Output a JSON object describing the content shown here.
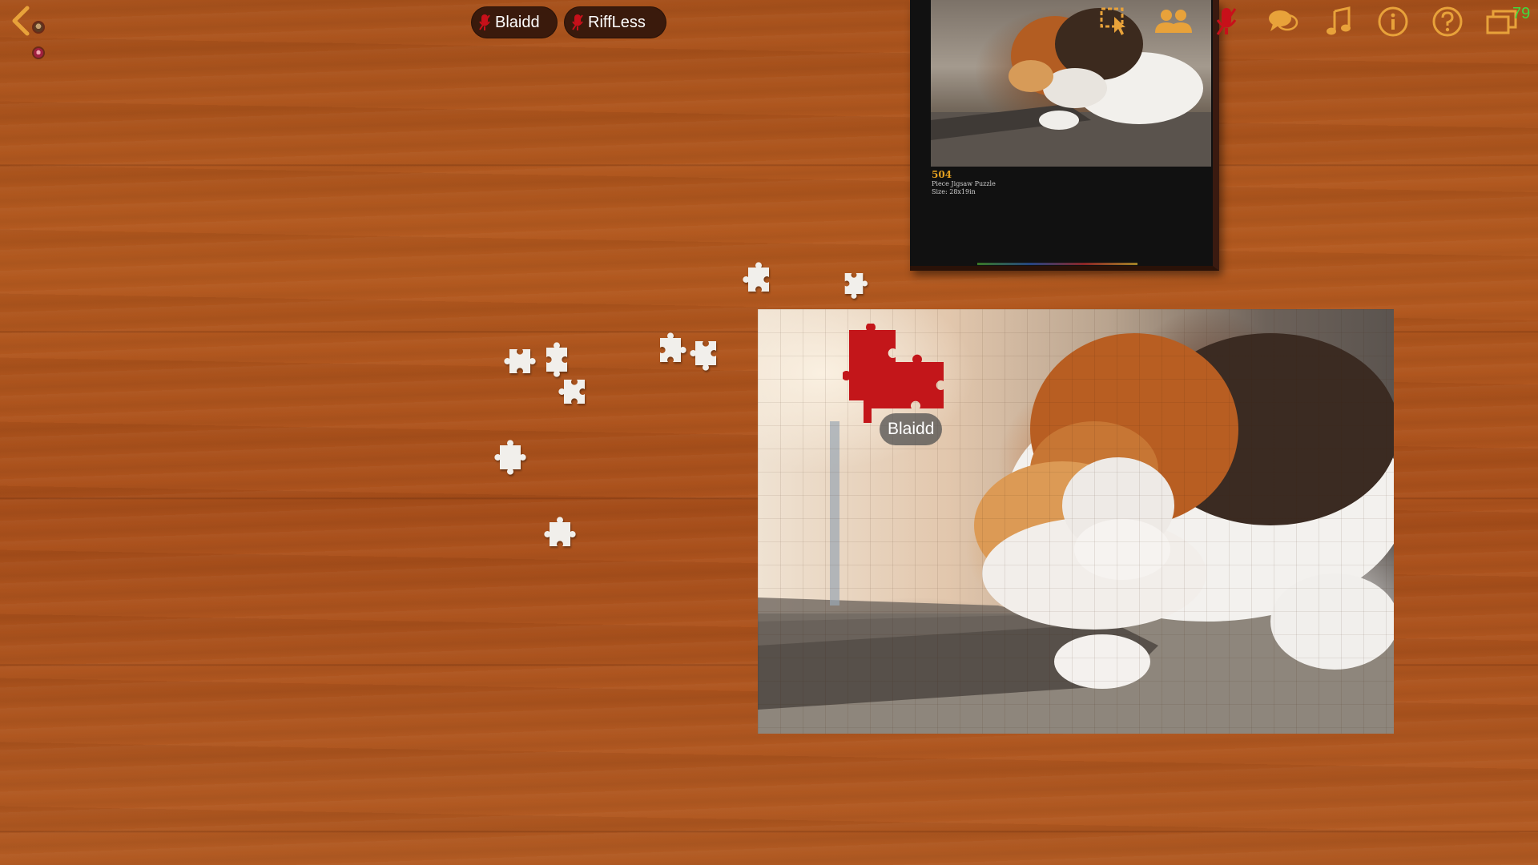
{
  "players": [
    {
      "name": "Blaidd",
      "mic": "mic-muted-icon"
    },
    {
      "name": "RiffLess",
      "mic": "mic-muted-icon"
    }
  ],
  "box": {
    "piece_count": "504",
    "desc_line1": "Piece Jigsaw Puzzle",
    "desc_line2": "Size: 28x19in"
  },
  "toolbar": [
    "select-tool-icon",
    "players-icon",
    "mic-muted-icon",
    "chat-icon",
    "music-icon",
    "info-icon",
    "help-icon",
    "windows-icon"
  ],
  "fps": "79",
  "cursor_label": "Blaidd",
  "colors": {
    "toolbar_icon": "#e8a23a",
    "mic_muted": "#c8101a",
    "held_piece": "#c3161a",
    "fps": "#3fdc3f",
    "chip_bg": "#3a1a0c"
  }
}
